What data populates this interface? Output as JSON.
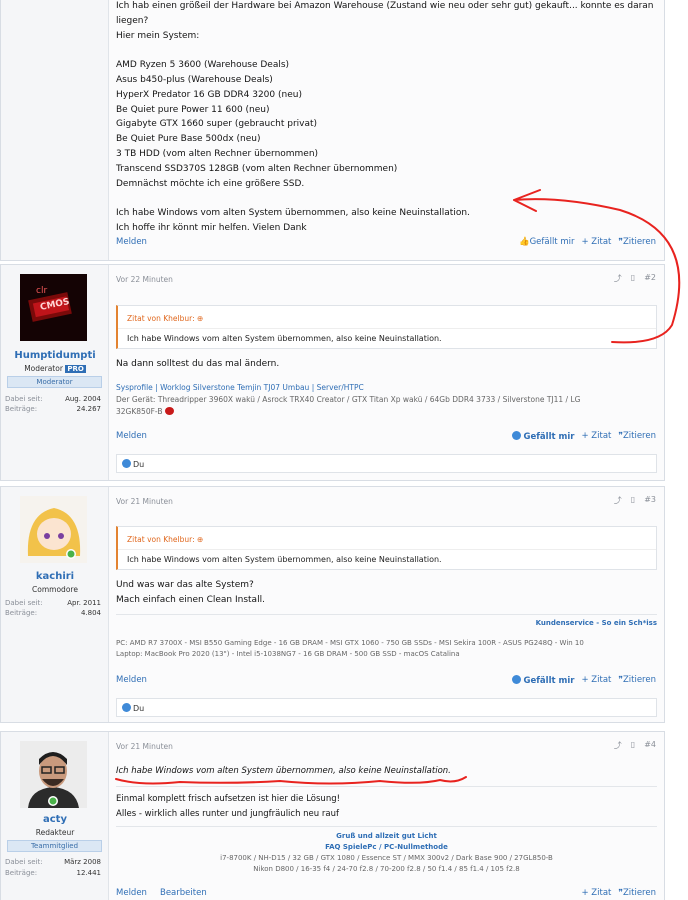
{
  "post1": {
    "lines": [
      "Ich hab einen größeil der Hardware bei Amazon Warehouse (Zustand wie neu oder sehr gut) gekauft... konnte es daran",
      "liegen?",
      "Hier mein System:",
      "",
      "AMD Ryzen 5 3600 (Warehouse Deals)",
      "Asus b450-plus (Warehouse Deals)",
      "HyperX Predator 16 GB DDR4 3200 (neu)",
      "Be Quiet pure Power 11 600 (neu)",
      "Gigabyte GTX 1660 super (gebraucht privat)",
      "Be Quiet Pure Base 500dx (neu)",
      "3 TB HDD (vom alten Rechner übernommen)",
      "Transcend SSD370S 128GB (vom alten Rechner übernommen)",
      "Demnächst möchte ich eine größere SSD.",
      "",
      "Ich habe Windows vom alten System übernommen, also keine Neuinstallation.",
      "Ich hoffe ihr könnt mir helfen. Vielen Dank"
    ],
    "report": "Melden",
    "like": "Gefällt mir",
    "quote": "+ Zitat",
    "cite": "Zitieren"
  },
  "post2": {
    "time": "Vor 22 Minuten",
    "num": "#2",
    "user": {
      "name": "Humptidumpti",
      "role": "Moderator",
      "pro": "PRO",
      "badge": "Moderator",
      "since_label": "Dabei seit:",
      "since": "Aug. 2004",
      "posts_label": "Beiträge:",
      "posts": "24.267",
      "avatar_text_1": "clr",
      "avatar_text_2": "CMOS"
    },
    "quote_header": "Zitat von Khelbur:",
    "quote_text": "Ich habe Windows vom alten System übernommen, also keine Neuinstallation.",
    "text": "Na dann solltest du das mal ändern.",
    "sig_links": "Sysprofile | Worklog Silverstone Temjin TJ07 Umbau | Server/HTPC",
    "sig_line2": "Der Gerät: Threadripper 3960X wakü / Asrock TRX40 Creator / GTX Titan Xp wakü / 64Gb DDR4 3733 / Silverstone TJ11 / LG",
    "sig_line3": "32GK850F-B",
    "report": "Melden",
    "like": "Gefällt mir",
    "quote": "+ Zitat",
    "cite": "Zitieren",
    "likes": "Du"
  },
  "post3": {
    "time": "Vor 21 Minuten",
    "num": "#3",
    "user": {
      "name": "kachiri",
      "role": "Commodore",
      "since_label": "Dabei seit:",
      "since": "Apr. 2011",
      "posts_label": "Beiträge:",
      "posts": "4.804"
    },
    "quote_header": "Zitat von Khelbur:",
    "quote_text": "Ich habe Windows vom alten System übernommen, also keine Neuinstallation.",
    "lines": [
      "Und was war das alte System?",
      "Mach einfach einen Clean Install."
    ],
    "sig_right": "Kundenservice - So ein Sch*iss",
    "sig_pc": "PC: AMD R7 3700X - MSI B550 Gaming Edge - 16 GB DRAM - MSI GTX 1060 - 750 GB SSDs - MSI Sekira 100R - ASUS PG248Q - Win 10",
    "sig_laptop": "Laptop: MacBook Pro 2020 (13\") - Intel i5-1038NG7 - 16 GB DRAM - 500 GB SSD - macOS Catalina",
    "report": "Melden",
    "like": "Gefällt mir",
    "quote": "+ Zitat",
    "cite": "Zitieren",
    "likes": "Du"
  },
  "post4": {
    "time": "Vor 21 Minuten",
    "num": "#4",
    "user": {
      "name": "acty",
      "role": "Redakteur",
      "badge": "Teammitglied",
      "since_label": "Dabei seit:",
      "since": "März 2008",
      "posts_label": "Beiträge:",
      "posts": "12.441"
    },
    "quote_italic": "Ich habe Windows vom alten System übernommen, also keine Neuinstallation.",
    "lines": [
      "Einmal komplett frisch aufsetzen ist hier die Lösung!",
      "Alles - wirklich alles runter und jungfräulich neu rauf"
    ],
    "sig1": "Gruß und allzeit gut Licht",
    "sig2": "FAQ SpielePc / PC-Nullmethode",
    "sig3": "i7-8700K / NH-D15 / 32 GB / GTX 1080 / Essence ST / MMX 300v2 / Dark Base 900 / 27GL850-B",
    "sig4": "Nikon D800 / 16-35 f4 / 24-70 f2.8 / 70-200 f2.8 / 50 f1.4 / 85 f1.4 / 105 f2.8",
    "report": "Melden",
    "edit": "Bearbeiten",
    "quote": "+ Zitat",
    "cite": "Zitieren"
  },
  "annotation_color": "#e8231f",
  "accent": "#2f6eb5"
}
